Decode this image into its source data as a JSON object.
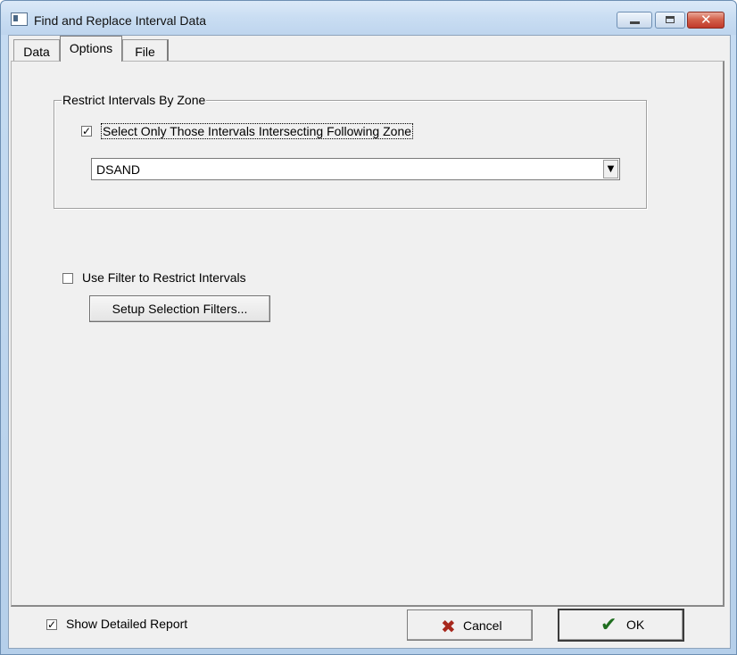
{
  "window": {
    "title": "Find and Replace Interval Data",
    "controls": {
      "minimize": "minimize-icon",
      "maximize": "maximize-icon",
      "close": "close-icon"
    }
  },
  "tabs": [
    {
      "label": "Data",
      "active": false
    },
    {
      "label": "Options",
      "active": true
    },
    {
      "label": "File",
      "active": false
    }
  ],
  "zone_group": {
    "legend": "Restrict Intervals By Zone",
    "checkbox_label": "Select Only Those Intervals Intersecting Following Zone",
    "checked": true,
    "zone_value": "DSAND"
  },
  "filter": {
    "checkbox_label": "Use Filter to Restrict Intervals",
    "checked": false,
    "button_label": "Setup Selection Filters..."
  },
  "footer": {
    "report_label": "Show Detailed Report",
    "report_checked": true,
    "cancel_label": "Cancel",
    "ok_label": "OK"
  }
}
